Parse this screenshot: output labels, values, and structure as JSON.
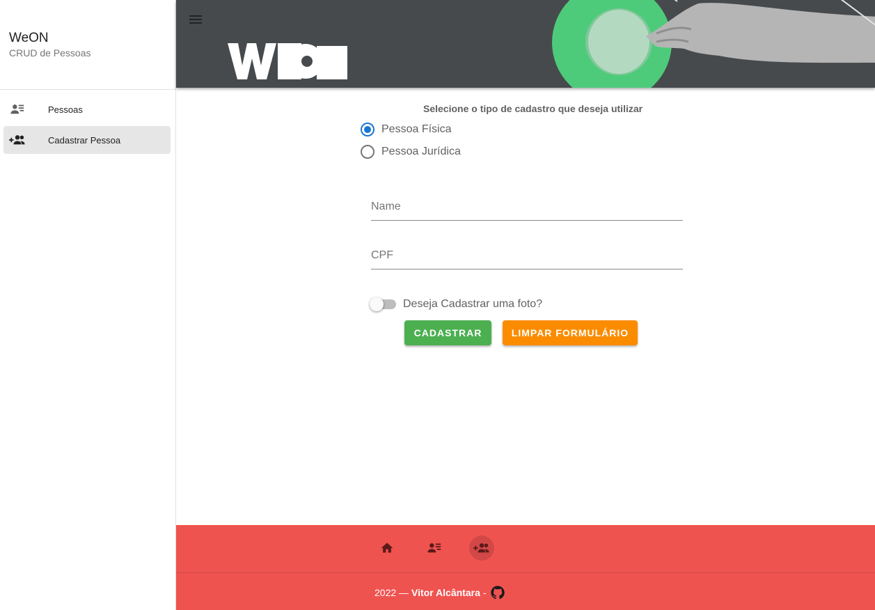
{
  "sidebar": {
    "app_name": "WeON",
    "app_subtitle": "CRUD de Pessoas",
    "items": [
      {
        "label": "Pessoas",
        "icon": "person-list-icon",
        "active": false
      },
      {
        "label": "Cadastrar Pessoa",
        "icon": "person-add-group-icon",
        "active": true
      }
    ]
  },
  "header": {
    "logo_text": "WEON",
    "menu_icon": "hamburger-menu-icon"
  },
  "form": {
    "title": "Selecione o tipo de cadastro que deseja utilizar",
    "person_types": [
      {
        "label": "Pessoa Física",
        "checked": true
      },
      {
        "label": "Pessoa Jurídica",
        "checked": false
      }
    ],
    "name_placeholder": "Name",
    "cpf_placeholder": "CPF",
    "photo_toggle_label": "Deseja Cadastrar uma foto?",
    "photo_toggle_on": false,
    "submit_label": "CADASTRAR",
    "clear_label": "LIMPAR FORMULÁRIO"
  },
  "footer": {
    "nav_icons": [
      "home-icon",
      "person-list-icon",
      "person-add-group-icon"
    ],
    "credit_prefix": "2022 —",
    "author": "Vitor Alcântara",
    "credit_suffix": "-",
    "github_icon": "github-icon"
  },
  "colors": {
    "banner": "#474a4d",
    "accent_green_circle": "#4ecb7a",
    "radio_checked": "#1976d2",
    "submit": "#4caf50",
    "clear": "#fb8c00",
    "footer": "#ef5350",
    "active_nav": "#e6e6e6"
  }
}
